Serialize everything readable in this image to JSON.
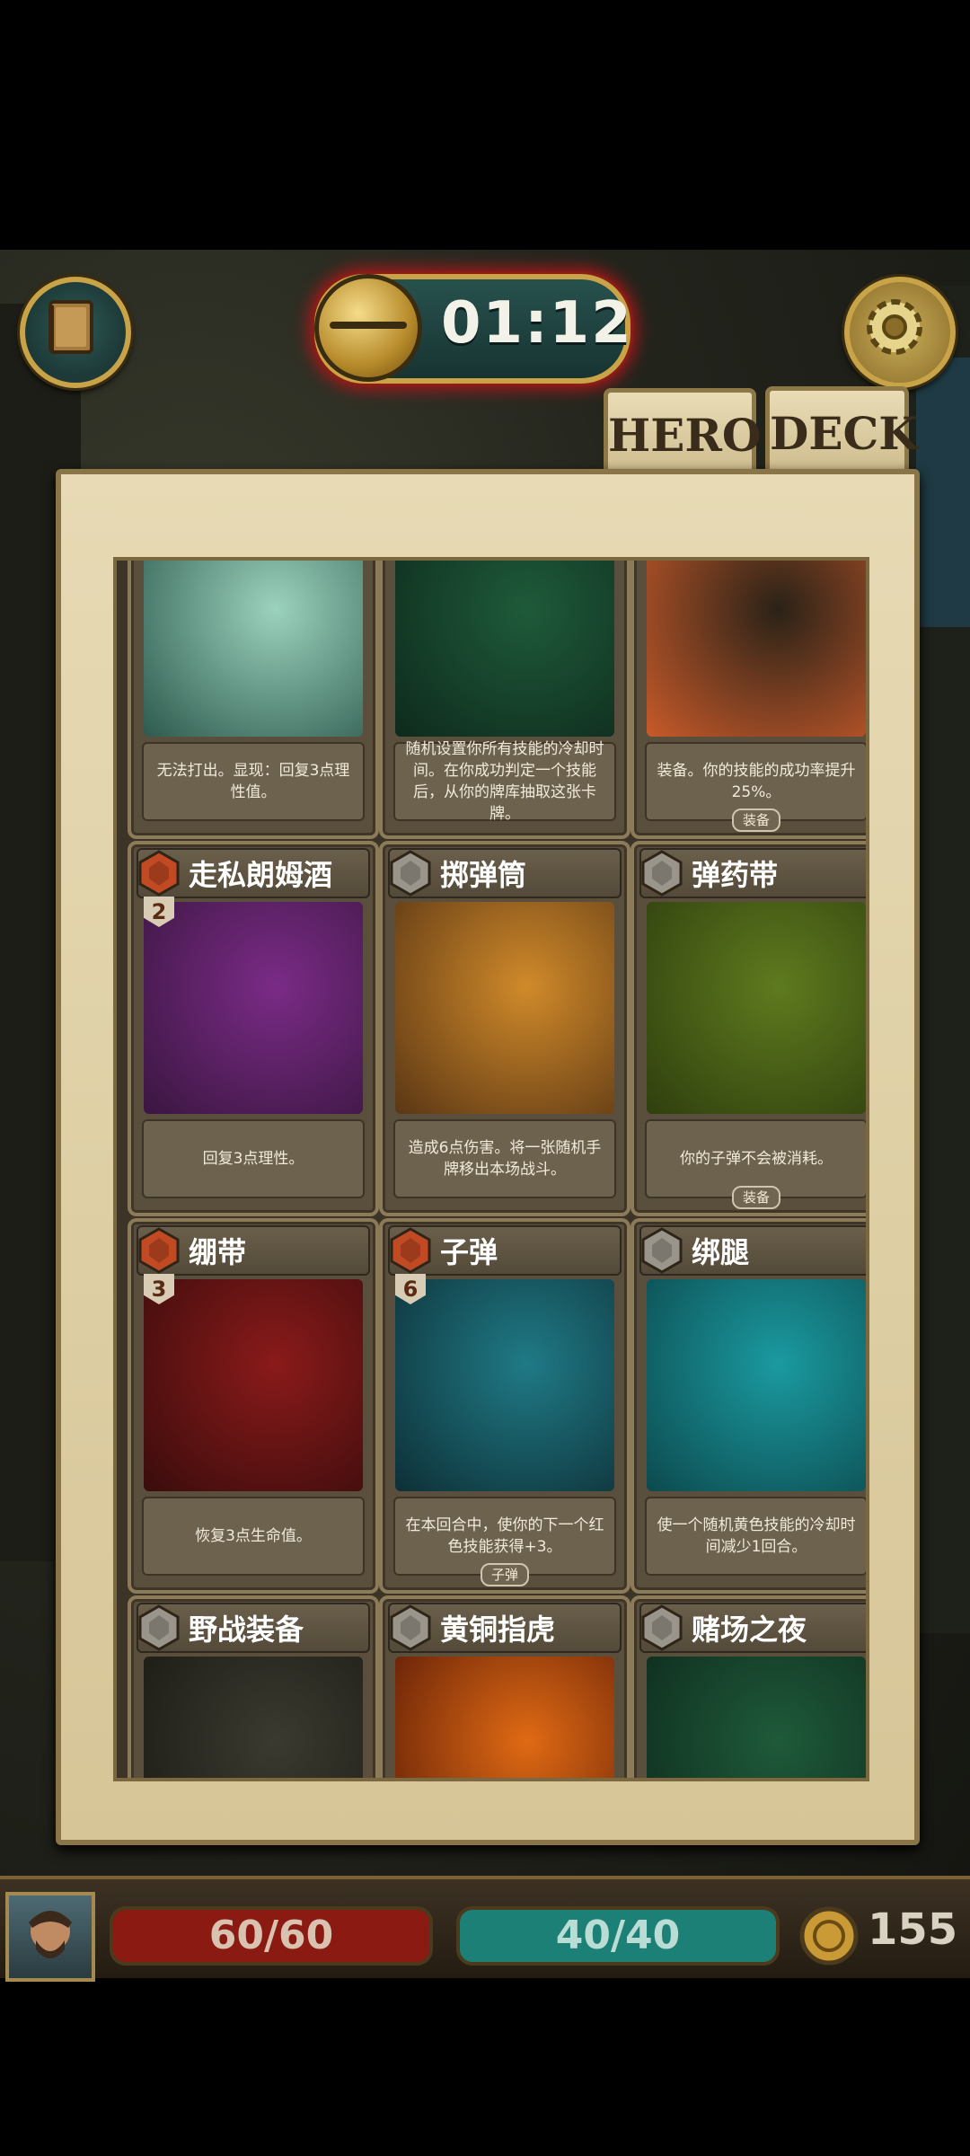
{
  "timer": "01:12",
  "tabs": [
    "HERO",
    "DECK"
  ],
  "cards": [
    {
      "name": "",
      "desc": "无法打出。显现：回复3点理性值。",
      "tag": ""
    },
    {
      "name": "",
      "desc": "随机设置你所有技能的冷却时间。在你成功判定一个技能后，从你的牌库抽取这张卡牌。",
      "tag": ""
    },
    {
      "name": "",
      "desc": "装备。你的技能的成功率提升25%。",
      "tag": "装备"
    },
    {
      "name": "走私朗姆酒",
      "cost": "2",
      "gem": "red",
      "desc": "回复3点理性。",
      "tag": ""
    },
    {
      "name": "掷弹筒",
      "gem": "gray",
      "desc": "造成6点伤害。将一张随机手牌移出本场战斗。",
      "tag": ""
    },
    {
      "name": "弹药带",
      "gem": "gray",
      "desc": "你的子弹不会被消耗。",
      "tag": "装备"
    },
    {
      "name": "绷带",
      "cost": "3",
      "gem": "red",
      "desc": "恢复3点生命值。",
      "tag": ""
    },
    {
      "name": "子弹",
      "cost": "6",
      "gem": "red",
      "desc": "在本回合中，使你的下一个红色技能获得+3。",
      "tag": "子弹"
    },
    {
      "name": "绑腿",
      "gem": "gray",
      "desc": "使一个随机黄色技能的冷却时间减少1回合。",
      "tag": ""
    },
    {
      "name": "野战装备",
      "gem": "gray",
      "desc": "",
      "tag": ""
    },
    {
      "name": "黄铜指虎",
      "gem": "gray",
      "desc": "",
      "tag": ""
    },
    {
      "name": "赌场之夜",
      "gem": "gray",
      "desc": "",
      "tag": ""
    }
  ],
  "stats": {
    "health": "60/60",
    "sanity": "40/40",
    "coins": "155"
  },
  "icons": {
    "left_button": "journal-icon",
    "right_button": "gear-icon",
    "coin": "coin-icon"
  },
  "colors": {
    "health": "#8a1a12",
    "sanity": "#1d8077",
    "accent_gold": "#c9a347"
  }
}
